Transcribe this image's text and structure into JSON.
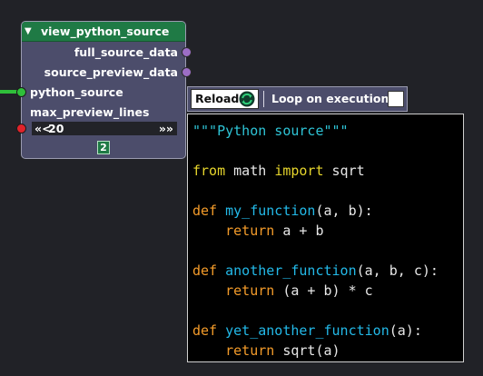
{
  "node": {
    "title": "view_python_source",
    "outputs": [
      {
        "label": "full_source_data"
      },
      {
        "label": "source_preview_data"
      }
    ],
    "inputs": [
      {
        "label": "python_source"
      },
      {
        "label": "max_preview_lines"
      }
    ],
    "max_preview_lines_value": "20",
    "arrow_left": "«<",
    "arrow_right": "»",
    "node_id": "2",
    "colors": {
      "header": "#1f7a45",
      "body": "#4c4d6b",
      "socket_out": "#9c6ec6",
      "socket_linked": "#2fbf3a",
      "socket_required": "#e0232b"
    }
  },
  "toolbar": {
    "reload_label": "Reload",
    "reload_icon": "reload-icon",
    "loop_label": "Loop on execution",
    "loop_checked": false
  },
  "code_preview": {
    "lines": [
      [
        {
          "t": "\"\"\"Python source\"\"\"",
          "k": "str"
        }
      ],
      [],
      [
        {
          "t": "from",
          "k": "kw-import"
        },
        {
          "t": " math ",
          "k": ""
        },
        {
          "t": "import",
          "k": "kw-import"
        },
        {
          "t": " sqrt",
          "k": ""
        }
      ],
      [],
      [
        {
          "t": "def",
          "k": "kw"
        },
        {
          "t": " ",
          "k": ""
        },
        {
          "t": "my_function",
          "k": "fn"
        },
        {
          "t": "(a, b):",
          "k": ""
        }
      ],
      [
        {
          "t": "    ",
          "k": ""
        },
        {
          "t": "return",
          "k": "kw"
        },
        {
          "t": " a + b",
          "k": ""
        }
      ],
      [],
      [
        {
          "t": "def",
          "k": "kw"
        },
        {
          "t": " ",
          "k": ""
        },
        {
          "t": "another_function",
          "k": "fn"
        },
        {
          "t": "(a, b, c):",
          "k": ""
        }
      ],
      [
        {
          "t": "    ",
          "k": ""
        },
        {
          "t": "return",
          "k": "kw"
        },
        {
          "t": " (a + b) * c",
          "k": ""
        }
      ],
      [],
      [
        {
          "t": "def",
          "k": "kw"
        },
        {
          "t": " ",
          "k": ""
        },
        {
          "t": "yet_another_function",
          "k": "fn"
        },
        {
          "t": "(a):",
          "k": ""
        }
      ],
      [
        {
          "t": "    ",
          "k": ""
        },
        {
          "t": "return",
          "k": "kw"
        },
        {
          "t": " sqrt(a)",
          "k": ""
        }
      ]
    ]
  }
}
